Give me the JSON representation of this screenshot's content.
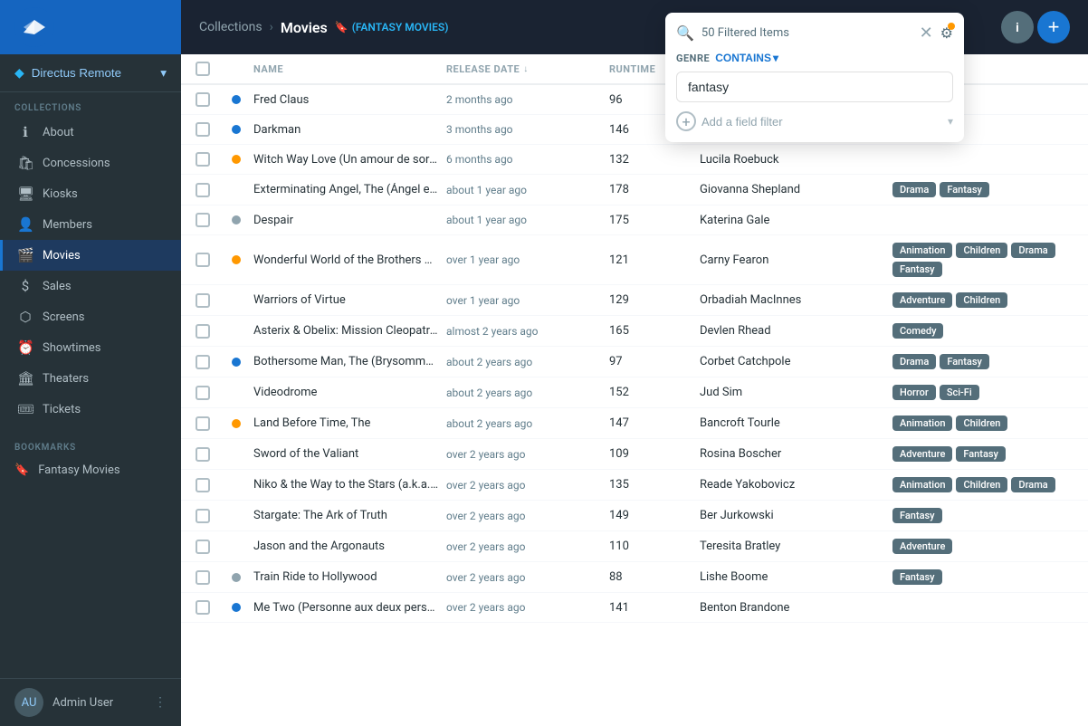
{
  "sidebar": {
    "logo_alt": "Directus logo",
    "user_section": {
      "name": "Directus Remote",
      "chevron": "▾"
    },
    "collections_label": "COLLECTIONS",
    "items": [
      {
        "id": "about",
        "label": "About",
        "icon": "ℹ",
        "active": false
      },
      {
        "id": "concessions",
        "label": "Concessions",
        "icon": "🛍",
        "active": false
      },
      {
        "id": "kiosks",
        "label": "Kiosks",
        "icon": "🖥",
        "active": false
      },
      {
        "id": "members",
        "label": "Members",
        "icon": "👤",
        "active": false
      },
      {
        "id": "movies",
        "label": "Movies",
        "icon": "🎬",
        "active": true
      },
      {
        "id": "sales",
        "label": "Sales",
        "icon": "$",
        "active": false
      },
      {
        "id": "screens",
        "label": "Screens",
        "icon": "⬡",
        "active": false
      },
      {
        "id": "showtimes",
        "label": "Showtimes",
        "icon": "⏰",
        "active": false
      },
      {
        "id": "theaters",
        "label": "Theaters",
        "icon": "🏛",
        "active": false
      },
      {
        "id": "tickets",
        "label": "Tickets",
        "icon": "🎟",
        "active": false
      }
    ],
    "bookmarks_label": "BOOKMARKS",
    "bookmarks": [
      {
        "id": "fantasy-movies",
        "label": "Fantasy Movies",
        "icon": "🔖"
      }
    ],
    "bottom": {
      "admin_name": "Admin User",
      "more_icon": "⋮"
    }
  },
  "header": {
    "breadcrumb_collections": "Collections",
    "breadcrumb_sep": "›",
    "breadcrumb_current": "Movies",
    "badge_icon": "🔖",
    "badge_label": "(FANTASY MOVIES)",
    "info_label": "i",
    "add_label": "+"
  },
  "filter": {
    "count_label": "50 Filtered Items",
    "genre_label": "GENRE",
    "contains_label": "CONTAINS",
    "search_value": "fantasy",
    "add_field_placeholder": "Add a field filter"
  },
  "table": {
    "columns": [
      {
        "id": "checkbox",
        "label": ""
      },
      {
        "id": "status",
        "label": ""
      },
      {
        "id": "name",
        "label": "NAME"
      },
      {
        "id": "release_date",
        "label": "RELEASE DATE",
        "sort": "↓"
      },
      {
        "id": "runtime",
        "label": "RUNTIME"
      },
      {
        "id": "director",
        "label": ""
      },
      {
        "id": "genres",
        "label": ""
      }
    ],
    "rows": [
      {
        "id": 1,
        "status": "published",
        "name": "Fred Claus",
        "release_date": "2 months ago",
        "runtime": "96",
        "director": "",
        "genres": []
      },
      {
        "id": 2,
        "status": "published",
        "name": "Darkman",
        "release_date": "3 months ago",
        "runtime": "146",
        "director": "",
        "genres": []
      },
      {
        "id": 3,
        "status": "draft",
        "name": "Witch Way Love (Un amour de sorc...",
        "release_date": "6 months ago",
        "runtime": "132",
        "director": "Lucila Roebuck",
        "genres": []
      },
      {
        "id": 4,
        "status": "none",
        "name": "Exterminating Angel, The (Ángel ex...",
        "release_date": "about 1 year ago",
        "runtime": "178",
        "director": "Giovanna Shepland",
        "genres": [
          "Drama",
          "Fantasy"
        ]
      },
      {
        "id": 5,
        "status": "grey",
        "name": "Despair",
        "release_date": "about 1 year ago",
        "runtime": "175",
        "director": "Katerina Gale",
        "genres": []
      },
      {
        "id": 6,
        "status": "draft",
        "name": "Wonderful World of the Brothers Gr...",
        "release_date": "over 1 year ago",
        "runtime": "121",
        "director": "Carny Fearon",
        "genres": [
          "Animation",
          "Children",
          "Drama",
          "Fantasy"
        ]
      },
      {
        "id": 7,
        "status": "none",
        "name": "Warriors of Virtue",
        "release_date": "over 1 year ago",
        "runtime": "129",
        "director": "Orbadiah MacInnes",
        "genres": [
          "Adventure",
          "Children"
        ]
      },
      {
        "id": 8,
        "status": "none",
        "name": "Asterix & Obelix: Mission Cleopatra...",
        "release_date": "almost 2 years ago",
        "runtime": "165",
        "director": "Devlen Rhead",
        "genres": [
          "Comedy"
        ]
      },
      {
        "id": 9,
        "status": "published",
        "name": "Bothersome Man, The (Brysomme ...",
        "release_date": "about 2 years ago",
        "runtime": "97",
        "director": "Corbet Catchpole",
        "genres": [
          "Drama",
          "Fantasy"
        ]
      },
      {
        "id": 10,
        "status": "none",
        "name": "Videodrome",
        "release_date": "about 2 years ago",
        "runtime": "152",
        "director": "Jud Sim",
        "genres": [
          "Horror",
          "Sci-Fi"
        ]
      },
      {
        "id": 11,
        "status": "draft",
        "name": "Land Before Time, The",
        "release_date": "about 2 years ago",
        "runtime": "147",
        "director": "Bancroft Tourle",
        "genres": [
          "Animation",
          "Children"
        ]
      },
      {
        "id": 12,
        "status": "none",
        "name": "Sword of the Valiant",
        "release_date": "over 2 years ago",
        "runtime": "109",
        "director": "Rosina Boscher",
        "genres": [
          "Adventure",
          "Fantasy"
        ]
      },
      {
        "id": 13,
        "status": "none",
        "name": "Niko & the Way to the Stars (a.k.a. ...",
        "release_date": "over 2 years ago",
        "runtime": "135",
        "director": "Reade Yakobovicz",
        "genres": [
          "Animation",
          "Children",
          "Drama"
        ]
      },
      {
        "id": 14,
        "status": "none",
        "name": "Stargate: The Ark of Truth",
        "release_date": "over 2 years ago",
        "runtime": "149",
        "director": "Ber Jurkowski",
        "genres": [
          "Fantasy"
        ]
      },
      {
        "id": 15,
        "status": "none",
        "name": "Jason and the Argonauts",
        "release_date": "over 2 years ago",
        "runtime": "110",
        "director": "Teresita Bratley",
        "genres": [
          "Adventure"
        ]
      },
      {
        "id": 16,
        "status": "grey",
        "name": "Train Ride to Hollywood",
        "release_date": "over 2 years ago",
        "runtime": "88",
        "director": "Lishe Boome",
        "genres": [
          "Fantasy"
        ]
      },
      {
        "id": 17,
        "status": "published",
        "name": "Me Two (Personne aux deux perso...",
        "release_date": "over 2 years ago",
        "runtime": "141",
        "director": "Benton Brandone",
        "genres": []
      }
    ]
  }
}
